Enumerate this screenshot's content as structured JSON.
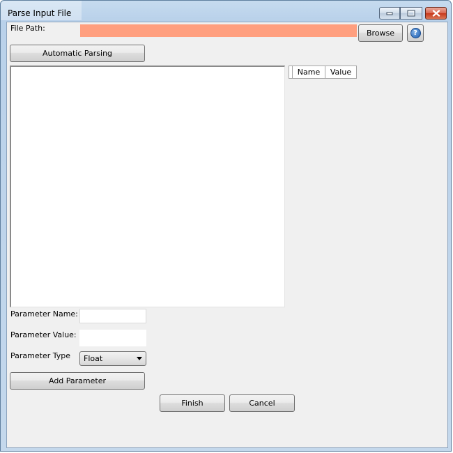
{
  "window": {
    "title": "Parse Input File"
  },
  "file_path": {
    "label": "File Path:",
    "value": "",
    "fill_color": "#ff9f7f"
  },
  "buttons": {
    "browse": "Browse",
    "help_glyph": "?",
    "automatic_parsing": "Automatic Parsing",
    "add_parameter": "Add Parameter",
    "finish": "Finish",
    "cancel": "Cancel"
  },
  "parameters_table": {
    "columns": [
      "Name",
      "Value"
    ]
  },
  "parameter_form": {
    "name_label": "Parameter Name:",
    "name_value": "",
    "value_label": "Parameter Value:",
    "value_value": "",
    "type_label": "Parameter Type",
    "type_selected": "Float"
  },
  "icons": {
    "help": "help-icon",
    "minimize": "minimize-icon",
    "maximize": "maximize-icon",
    "close": "close-icon",
    "dropdown": "chevron-down-icon"
  }
}
